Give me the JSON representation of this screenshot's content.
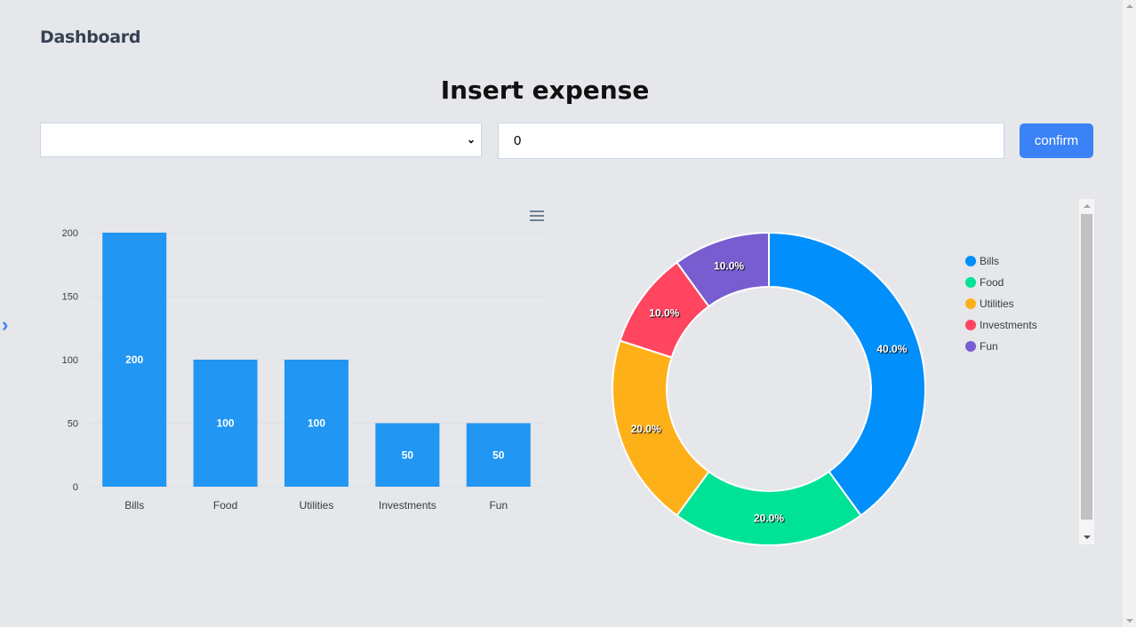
{
  "header": {
    "title": "Dashboard"
  },
  "form": {
    "title": "Insert expense",
    "category_value": "",
    "amount_value": "0",
    "confirm_label": "confirm"
  },
  "chart_data": [
    {
      "type": "bar",
      "categories": [
        "Bills",
        "Food",
        "Utilities",
        "Investments",
        "Fun"
      ],
      "values": [
        200,
        100,
        100,
        50,
        50
      ],
      "yticks": [
        0,
        50,
        100,
        150,
        200
      ],
      "ylim": [
        0,
        200
      ],
      "grid": true,
      "color": "#2196f3",
      "data_labels": [
        "200",
        "100",
        "100",
        "50",
        "50"
      ]
    },
    {
      "type": "pie",
      "donut": true,
      "categories": [
        "Bills",
        "Food",
        "Utilities",
        "Investments",
        "Fun"
      ],
      "values": [
        40,
        20,
        20,
        10,
        10
      ],
      "labels": [
        "40.0%",
        "20.0%",
        "20.0%",
        "10.0%",
        "10.0%"
      ],
      "colors": [
        "#008ffb",
        "#00e396",
        "#feb019",
        "#ff4560",
        "#775dd0"
      ],
      "legend": "right"
    }
  ],
  "icons": {
    "menu": "hamburger-icon",
    "side": "chevron-right-icon"
  }
}
